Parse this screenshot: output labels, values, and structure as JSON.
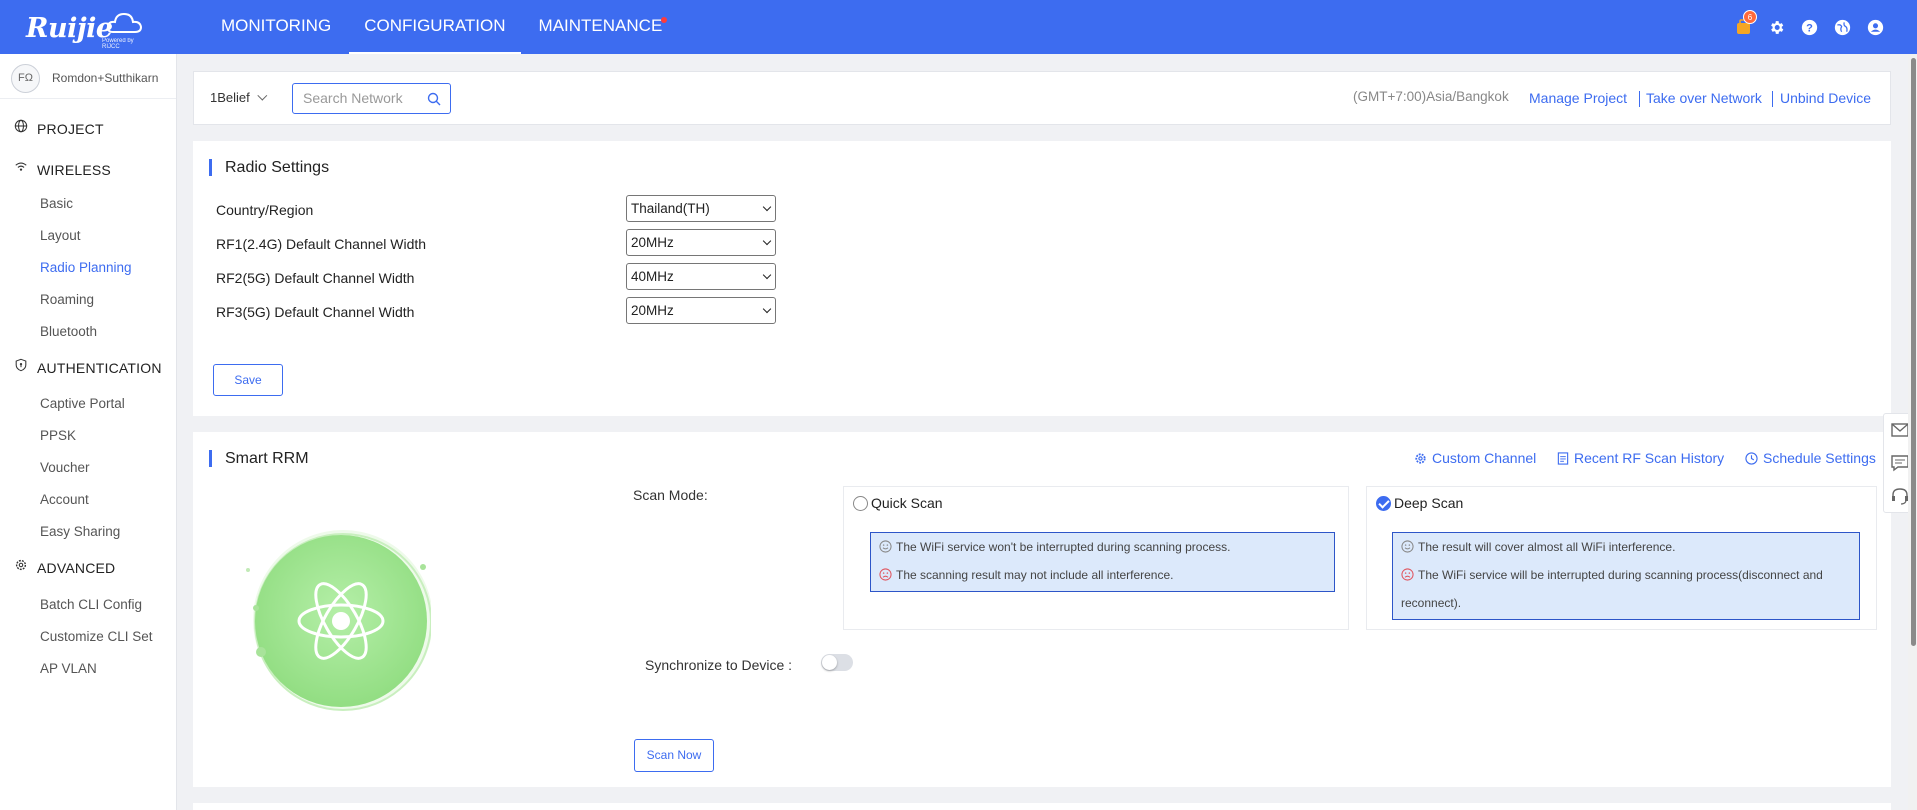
{
  "brand": {
    "name": "Ruijie",
    "tagline": "Powered by RIJCC"
  },
  "nav": {
    "monitoring": "MONITORING",
    "configuration": "CONFIGURATION",
    "maintenance": "MAINTENANCE"
  },
  "top_icons": {
    "notifications_count": "6"
  },
  "sidebar": {
    "user_initials": "FΩ",
    "user_name": "Romdon+Sutthikarn",
    "project": "PROJECT",
    "wireless": "WIRELESS",
    "wireless_items": [
      "Basic",
      "Layout",
      "Radio Planning",
      "Roaming",
      "Bluetooth"
    ],
    "authentication": "AUTHENTICATION",
    "authentication_items": [
      "Captive Portal",
      "PPSK",
      "Voucher",
      "Account",
      "Easy Sharing"
    ],
    "advanced": "ADVANCED",
    "advanced_items": [
      "Batch CLI Config",
      "Customize CLI Set",
      "AP VLAN"
    ]
  },
  "filterbar": {
    "network": "1Belief",
    "search_placeholder": "Search Network",
    "timezone": "(GMT+7:00)Asia/Bangkok",
    "manage_project": "Manage Project",
    "take_over": "Take over Network",
    "unbind": "Unbind Device"
  },
  "radio_settings": {
    "title": "Radio Settings",
    "fields": [
      {
        "label": "Country/Region",
        "value": "Thailand(TH)"
      },
      {
        "label": "RF1(2.4G) Default Channel Width",
        "value": "20MHz"
      },
      {
        "label": "RF2(5G) Default Channel Width",
        "value": "40MHz"
      },
      {
        "label": "RF3(5G) Default Channel Width",
        "value": "20MHz"
      }
    ],
    "save": "Save"
  },
  "smart_rrm": {
    "title": "Smart RRM",
    "custom_channel": "Custom Channel",
    "recent_history": "Recent RF Scan History",
    "schedule": "Schedule Settings",
    "scan_mode_label": "Scan Mode:",
    "quick": {
      "label": "Quick Scan",
      "pro": "The WiFi service won't be interrupted during scanning process.",
      "con": "The scanning result may not include all interference."
    },
    "deep": {
      "label": "Deep Scan",
      "selected": true,
      "pro": "The result will cover almost all WiFi interference.",
      "con_line1": "The WiFi service will be interrupted during scanning process(disconnect and",
      "con_line2": "reconnect)."
    },
    "sync_label": "Synchronize to Device :",
    "sync_enabled": false,
    "scan_now": "Scan Now"
  },
  "colors": {
    "primary": "#3d6cf0",
    "info_bg": "#dce9fb",
    "happy": "#888888",
    "sad": "#e0555f"
  }
}
